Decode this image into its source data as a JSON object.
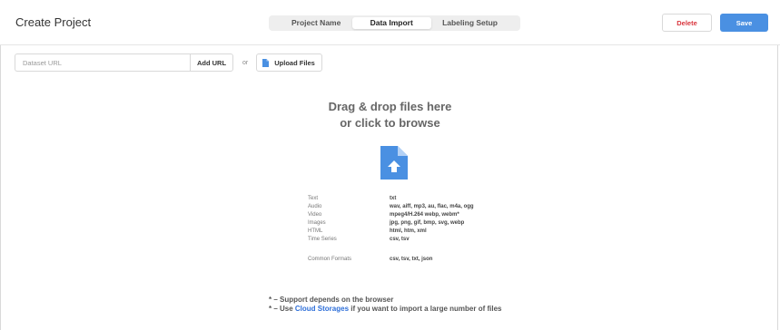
{
  "header": {
    "title": "Create Project",
    "tabs": [
      {
        "label": "Project Name",
        "active": false
      },
      {
        "label": "Data Import",
        "active": true
      },
      {
        "label": "Labeling Setup",
        "active": false
      }
    ],
    "delete_label": "Delete",
    "save_label": "Save"
  },
  "import_bar": {
    "url_placeholder": "Dataset URL",
    "add_url_label": "Add URL",
    "or_label": "or",
    "upload_label": "Upload Files"
  },
  "drop_zone": {
    "title_line1": "Drag & drop files here",
    "title_line2": "or click to browse",
    "icon": "file-upload-icon",
    "formats": [
      {
        "name": "Text",
        "ext": "txt"
      },
      {
        "name": "Audio",
        "ext": "wav, aiff, mp3, au, flac, m4a, ogg"
      },
      {
        "name": "Video",
        "ext": "mpeg4/H.264 webp, webm*"
      },
      {
        "name": "Images",
        "ext": "jpg, png, gif, bmp, svg, webp"
      },
      {
        "name": "HTML",
        "ext": "html, htm, xml"
      },
      {
        "name": "Time Series",
        "ext": "csv, tsv"
      }
    ],
    "common": {
      "name": "Common Formats",
      "ext": "csv, tsv, txt, json"
    },
    "note1": "* – Support depends on the browser",
    "note2_prefix": "* – Use ",
    "note2_link": "Cloud Storages",
    "note2_suffix": " if you want to import a large number of files"
  },
  "colors": {
    "accent": "#4a90e2",
    "danger": "#d9363e",
    "link": "#2e6fd9",
    "icon": "#4a90e2"
  }
}
